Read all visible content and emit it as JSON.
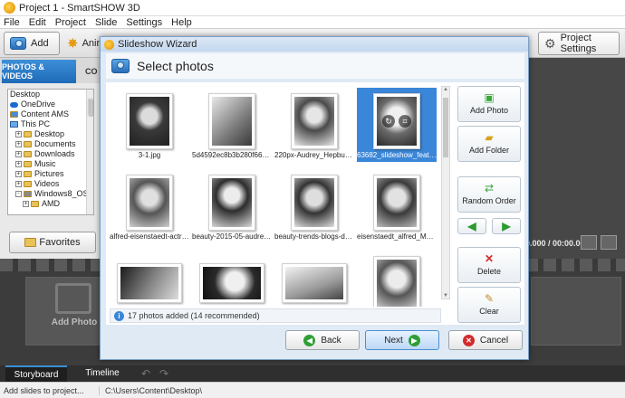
{
  "app": {
    "title": "Project 1 - SmartSHOW 3D"
  },
  "menu": [
    "File",
    "Edit",
    "Project",
    "Slide",
    "Settings",
    "Help"
  ],
  "toolbar": {
    "add_label": "Add",
    "animation_label": "Anim",
    "project_settings_label": "Project Settings"
  },
  "left_panel": {
    "tab_photos": "PHOTOS & VIDEOS",
    "tab_other": "CO",
    "tree": [
      {
        "label": "Desktop",
        "icon": "none",
        "exp": ""
      },
      {
        "label": "OneDrive",
        "icon": "cloud-icon",
        "exp": ""
      },
      {
        "label": "Content AMS",
        "icon": "user-icon",
        "exp": ""
      },
      {
        "label": "This PC",
        "icon": "computer-icon",
        "exp": ""
      },
      {
        "label": "Desktop",
        "icon": "folder-icon",
        "exp": "+"
      },
      {
        "label": "Documents",
        "icon": "folder-icon",
        "exp": "+"
      },
      {
        "label": "Downloads",
        "icon": "folder-icon",
        "exp": "+"
      },
      {
        "label": "Music",
        "icon": "folder-icon",
        "exp": "+"
      },
      {
        "label": "Pictures",
        "icon": "folder-icon",
        "exp": "+"
      },
      {
        "label": "Videos",
        "icon": "folder-icon",
        "exp": "+"
      },
      {
        "label": "Windows8_OS",
        "icon": "drive-icon",
        "exp": "-"
      },
      {
        "label": "AMD",
        "icon": "folder-icon",
        "exp": "+"
      }
    ],
    "favorites_label": "Favorites"
  },
  "preview": {
    "time": "0.000 / 00:00.000"
  },
  "storyboard": {
    "add_photo_label": "Add Photo"
  },
  "bottom_tabs": {
    "storyboard": "Storyboard",
    "timeline": "Timeline"
  },
  "status": {
    "hint": "Add slides to project...",
    "path": "C:\\Users\\Content\\Desktop\\"
  },
  "dialog": {
    "title": "Slideshow Wizard",
    "header": "Select photos",
    "photos": [
      {
        "caption": "3-1.jpg",
        "selected": false
      },
      {
        "caption": "5d4592ec8b3b280f66c5...",
        "selected": false
      },
      {
        "caption": "220px-Audrey_Hepburn...",
        "selected": false
      },
      {
        "caption": "63682_slideshow_featur...",
        "selected": true
      },
      {
        "caption": "alfred-eisenstaedt-actre...",
        "selected": false
      },
      {
        "caption": "beauty-2015-05-audrey...",
        "selected": false
      },
      {
        "caption": "beauty-trends-blogs-dail...",
        "selected": false
      },
      {
        "caption": "eisenstaedt_alfred_Maril...",
        "selected": false
      },
      {
        "caption": "",
        "selected": false
      },
      {
        "caption": "",
        "selected": false
      },
      {
        "caption": "",
        "selected": false
      },
      {
        "caption": "",
        "selected": false
      }
    ],
    "info": "17 photos added (14 recommended)",
    "buttons": {
      "add_photo": "Add Photo",
      "add_folder": "Add Folder",
      "random_order": "Random Order",
      "delete": "Delete",
      "clear": "Clear",
      "back": "Back",
      "next": "Next",
      "cancel": "Cancel"
    }
  }
}
